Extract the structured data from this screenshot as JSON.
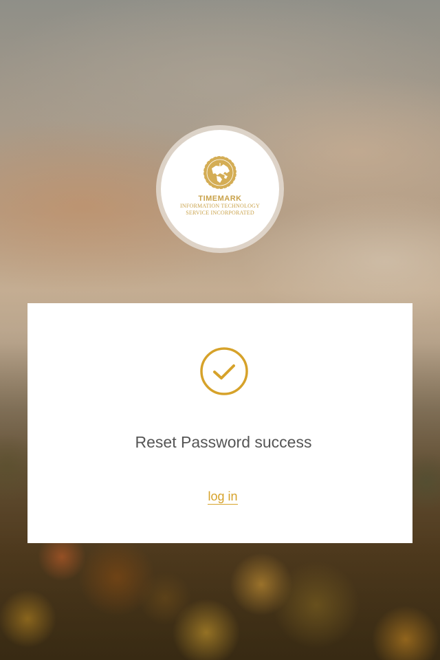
{
  "logo": {
    "name": "TIMEMARK",
    "subtitle_line1": "INFORMATION TECHNOLOGY",
    "subtitle_line2": "SERVICE INCORPORATED",
    "accent_color": "#c9a24a"
  },
  "card": {
    "status_icon": "check-circle-icon",
    "message": "Reset Password success",
    "login_link": "log in"
  },
  "colors": {
    "accent": "#d6a22a",
    "message_text": "#555555",
    "card_background": "#ffffff"
  }
}
